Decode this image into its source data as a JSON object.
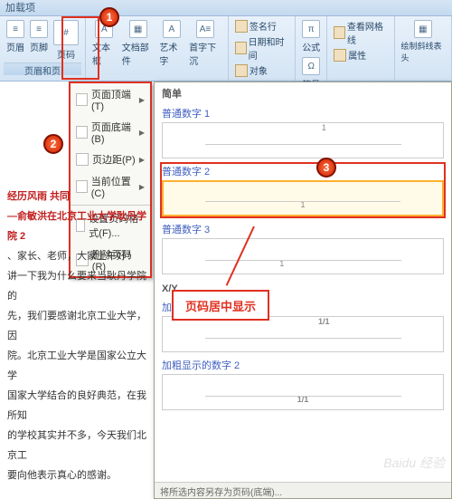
{
  "window": {
    "title": "加载项"
  },
  "ribbon": {
    "btns": {
      "header": "页眉",
      "footer": "页脚",
      "pagenum": "页码",
      "textbox": "文本框",
      "docparts": "文档部件",
      "wordart": "艺术字",
      "dropcap": "首字下沉"
    },
    "right": {
      "sig": "签名行",
      "datetime": "日期和时间",
      "object": "对象",
      "equation": "公式",
      "symbol": "符号",
      "viewgrid": "查看网格线",
      "props": "属性",
      "drawtable": "绘制斜线表头"
    },
    "groups": {
      "headfoot": "页眉和页"
    }
  },
  "dropdown": {
    "items": [
      "页面顶端(T)",
      "页面底端(B)",
      "页边距(P)",
      "当前位置(C)",
      "设置页码格式(F)...",
      "删除页码(R)"
    ]
  },
  "gallery": {
    "section1": "简单",
    "items": [
      {
        "label": "普通数字 1",
        "num": "1",
        "align": "left"
      },
      {
        "label": "普通数字 2",
        "num": "1",
        "align": "center"
      },
      {
        "label": "普通数字 3",
        "num": "1",
        "align": "right"
      }
    ],
    "section2": "X/Y",
    "items2": [
      {
        "label": "加粗显示的数字 1",
        "num": "1/1",
        "align": "left"
      },
      {
        "label": "加粗显示的数字 2",
        "num": "1/1",
        "align": "center"
      }
    ],
    "footer": "将所选内容另存为页码(底端)..."
  },
  "document": {
    "line1": "经历风雨 共同",
    "line2": "—俞敏洪在北京工业大学耿丹学院 2",
    "p1": "、家长、老师，大家上午好！",
    "p2": "讲一下我为什么要来当耿丹学院的",
    "p3": "先，我们要感谢北京工业大学，因",
    "p4": "院。北京工业大学是国家公立大学",
    "p5": "国家大学结合的良好典范，在我所知",
    "p6": "的学校其实并不多，今天我们北京工",
    "p7": "要向他表示真心的感谢。"
  },
  "callout": {
    "text": "页码居中显示"
  },
  "badges": {
    "b1": "1",
    "b2": "2",
    "b3": "3"
  },
  "watermark": "Baidu 经验"
}
